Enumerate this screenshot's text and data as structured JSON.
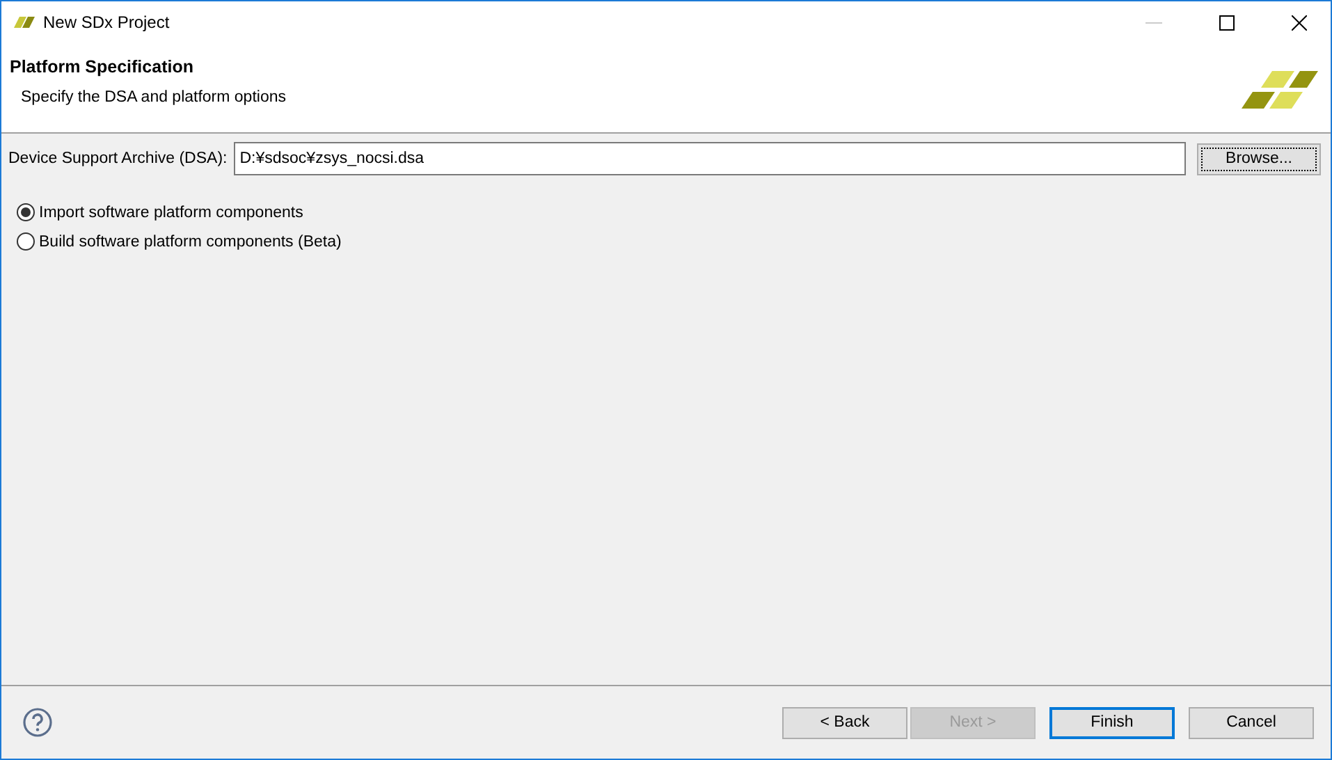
{
  "window": {
    "title": "New SDx Project"
  },
  "header": {
    "title": "Platform Specification",
    "subtitle": "Specify the DSA and platform options"
  },
  "dsa": {
    "label": "Device Support Archive (DSA):",
    "value": "D:¥sdsoc¥zsys_nocsi.dsa",
    "browse": "Browse..."
  },
  "options": [
    {
      "label": "Import software platform components",
      "selected": true
    },
    {
      "label": "Build software platform components (Beta)",
      "selected": false
    }
  ],
  "buttons": [
    {
      "label": "< Back",
      "disabled": false,
      "default": false
    },
    {
      "label": "Next >",
      "disabled": true,
      "default": false
    },
    {
      "label": "Finish",
      "disabled": false,
      "default": true
    },
    {
      "label": "Cancel",
      "disabled": false,
      "default": false
    }
  ]
}
